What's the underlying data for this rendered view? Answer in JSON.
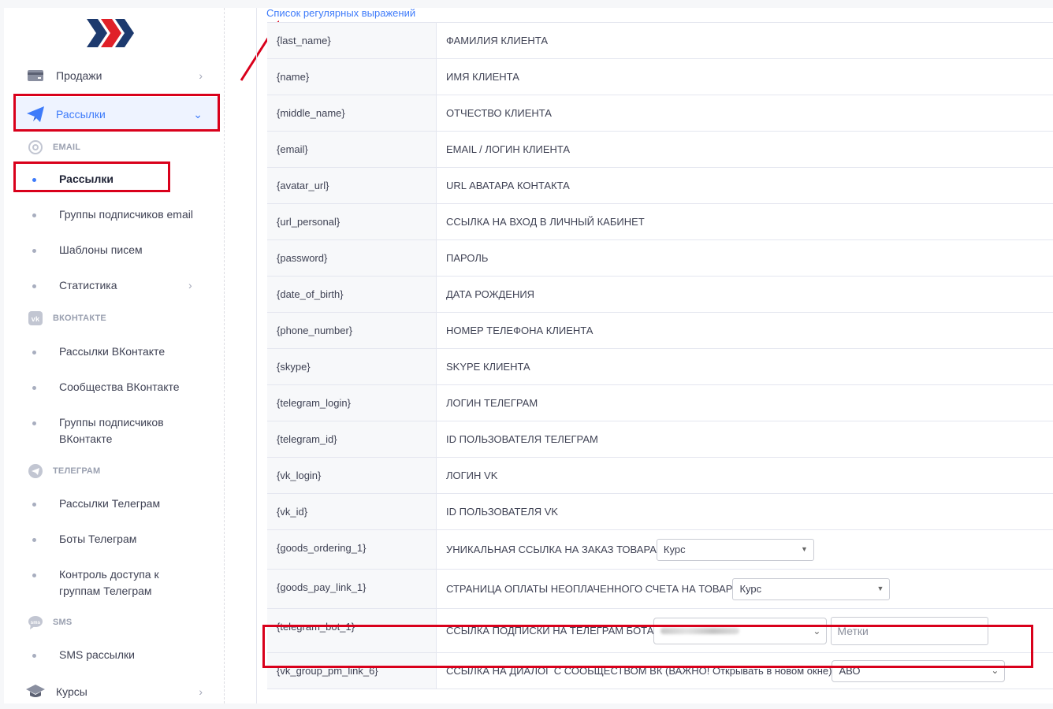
{
  "sidebar": {
    "sales": "Продажи",
    "mailings": "Рассылки",
    "email_section": "EMAIL",
    "email_items": [
      "Рассылки",
      "Группы подписчиков email",
      "Шаблоны писем",
      "Статистика"
    ],
    "vk_section": "ВКОНТАКТЕ",
    "vk_items": [
      "Рассылки ВКонтакте",
      "Сообщества ВКонтакте",
      "Группы подписчиков ВКонтакте"
    ],
    "tg_section": "ТЕЛЕГРАМ",
    "tg_items": [
      "Рассылки Телеграм",
      "Боты Телеграм",
      "Контроль доступа к группам Телеграм"
    ],
    "sms_section": "SMS",
    "sms_items": [
      "SMS рассылки"
    ],
    "courses": "Курсы"
  },
  "main": {
    "list_link": "Список регулярных выражений",
    "rows": [
      {
        "var": "{last_name}",
        "desc": "ФАМИЛИЯ КЛИЕНТА"
      },
      {
        "var": "{name}",
        "desc": "ИМЯ КЛИЕНТА"
      },
      {
        "var": "{middle_name}",
        "desc": "ОТЧЕСТВО КЛИЕНТА"
      },
      {
        "var": "{email}",
        "desc": "EMAIL / ЛОГИН КЛИЕНТА"
      },
      {
        "var": "{avatar_url}",
        "desc": "URL АВАТАРА КОНТАКТА"
      },
      {
        "var": "{url_personal}",
        "desc": "ССЫЛКА НА ВХОД В ЛИЧНЫЙ КАБИНЕТ"
      },
      {
        "var": "{password}",
        "desc": "ПАРОЛЬ"
      },
      {
        "var": "{date_of_birth}",
        "desc": "ДАТА РОЖДЕНИЯ"
      },
      {
        "var": "{phone_number}",
        "desc": "НОМЕР ТЕЛЕФОНА КЛИЕНТА"
      },
      {
        "var": "{skype}",
        "desc": "SKYPE КЛИЕНТА"
      },
      {
        "var": "{telegram_login}",
        "desc": "ЛОГИН ТЕЛЕГРАМ"
      },
      {
        "var": "{telegram_id}",
        "desc": "ID ПОЛЬЗОВАТЕЛЯ ТЕЛЕГРАМ"
      },
      {
        "var": "{vk_login}",
        "desc": "ЛОГИН VK"
      },
      {
        "var": "{vk_id}",
        "desc": "ID ПОЛЬЗОВАТЕЛЯ VK"
      },
      {
        "var": "{goods_ordering_1}",
        "desc": "УНИКАЛЬНАЯ ССЫЛКА НА ЗАКАЗ ТОВАРА",
        "select": "Курс"
      },
      {
        "var": "{goods_pay_link_1}",
        "desc": "СТРАНИЦА ОПЛАТЫ НЕОПЛАЧЕННОГО СЧЕТА НА ТОВАР",
        "select": "Курс"
      },
      {
        "var": "{telegram_bot_1}",
        "desc": "ССЫЛКА ПОДПИСКИ НА ТЕЛЕГРАМ БОТА",
        "tags_placeholder": "Метки"
      },
      {
        "var": "{vk_group_pm_link_6}",
        "desc": "ССЫЛКА НА ДИАЛОГ С СООБЩЕСТВОМ ВК (ВАЖНО! Открывать в новом окне)",
        "select": "АВО"
      }
    ]
  },
  "colors": {
    "accent": "#3e7bfa",
    "highlight": "#d9001b",
    "logo_red": "#e02028",
    "logo_navy": "#1d3a6e"
  }
}
